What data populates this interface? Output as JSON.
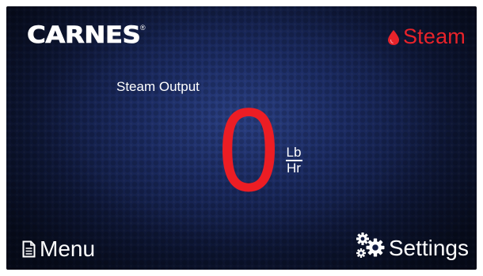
{
  "brand": {
    "logo_text": "CARNES",
    "registered_mark": "®"
  },
  "mode": {
    "label": "Steam",
    "icon": "water-drop-icon",
    "color": "#e8232a"
  },
  "output": {
    "label": "Steam Output",
    "value": "0",
    "unit_numerator": "Lb",
    "unit_denominator": "Hr",
    "value_color": "#ec1d24"
  },
  "nav": {
    "menu_label": "Menu",
    "menu_icon": "document-icon",
    "settings_label": "Settings",
    "settings_icon": "gears-icon"
  },
  "theme": {
    "background": "#1c2c63",
    "text": "#ffffff"
  }
}
